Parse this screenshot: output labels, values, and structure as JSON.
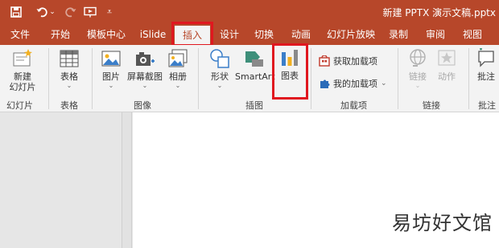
{
  "window": {
    "title": "新建 PPTX 演示文稿.pptx"
  },
  "quick_access": {
    "save_icon": "save-icon",
    "undo_icon": "undo-icon",
    "redo_icon": "redo-icon",
    "present_icon": "present-from-start-icon",
    "customize_icon": "customize-icon"
  },
  "tabs": [
    {
      "label": "文件"
    },
    {
      "label": "开始"
    },
    {
      "label": "模板中心"
    },
    {
      "label": "iSlide"
    },
    {
      "label": "插入"
    },
    {
      "label": "设计"
    },
    {
      "label": "切换"
    },
    {
      "label": "动画"
    },
    {
      "label": "幻灯片放映"
    },
    {
      "label": "录制"
    },
    {
      "label": "审阅"
    },
    {
      "label": "视图"
    }
  ],
  "active_tab": "插入",
  "ribbon": {
    "new_slide": {
      "line1": "新建",
      "line2": "幻灯片"
    },
    "table": {
      "label": "表格"
    },
    "picture": {
      "label": "图片"
    },
    "screenshot": {
      "label": "屏幕截图"
    },
    "album": {
      "label": "相册"
    },
    "shapes": {
      "label": "形状"
    },
    "smartart": {
      "label": "SmartArt"
    },
    "chart": {
      "label": "图表"
    },
    "get_addins": {
      "label": "获取加载项"
    },
    "my_addins": {
      "label": "我的加载项"
    },
    "link": {
      "label": "链接"
    },
    "action": {
      "label": "动作"
    },
    "comment": {
      "label": "批注"
    }
  },
  "groups": {
    "slides": "幻灯片",
    "tables": "表格",
    "images": "图像",
    "illustrations": "插图",
    "addins": "加载项",
    "links": "链接",
    "comments": "批注"
  },
  "watermark": "易坊好文馆",
  "colors": {
    "accent": "#b7472a",
    "highlight": "#e0171f",
    "ribbon_bg": "#f3f3f3"
  }
}
